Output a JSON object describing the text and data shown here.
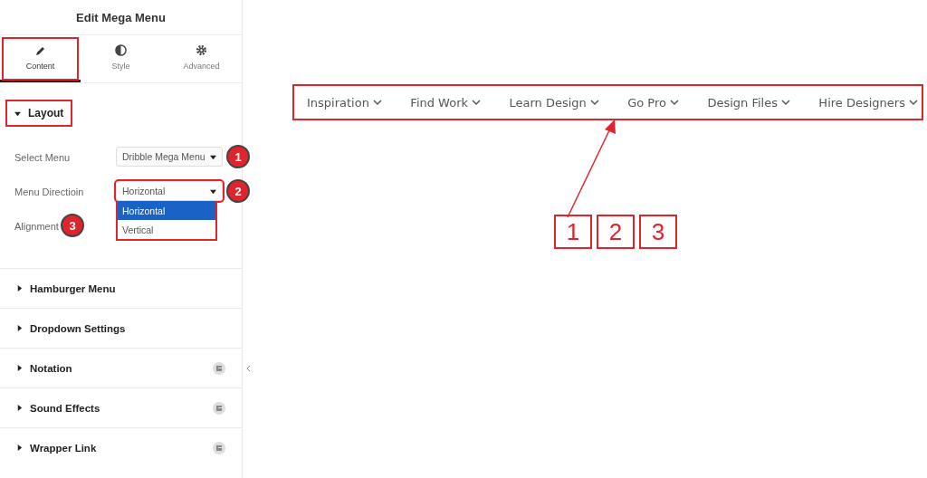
{
  "panel": {
    "title": "Edit Mega Menu",
    "tabs": [
      {
        "label": "Content",
        "selected": true,
        "highlighted": true
      },
      {
        "label": "Style",
        "selected": false,
        "highlighted": false
      },
      {
        "label": "Advanced",
        "selected": false,
        "highlighted": false
      }
    ],
    "layout": {
      "title": "Layout",
      "expanded": true,
      "highlighted": true,
      "fields": [
        {
          "label": "Select Menu",
          "value": "Dribble Mega Menu",
          "marker": "1",
          "highlighted": false
        },
        {
          "label": "Menu Directioin",
          "value": "Horizontal",
          "marker": "2",
          "open": true,
          "highlighted": true,
          "options": [
            {
              "label": "Horizontal",
              "selected": true
            },
            {
              "label": "Vertical",
              "selected": false
            }
          ]
        },
        {
          "label": "Alignment",
          "marker": "3"
        }
      ]
    },
    "sections": [
      {
        "title": "Hamburger Menu",
        "pro": false
      },
      {
        "title": "Dropdown Settings",
        "pro": false
      },
      {
        "title": "Notation",
        "pro": true
      },
      {
        "title": "Sound Effects",
        "pro": true
      },
      {
        "title": "Wrapper Link",
        "pro": true
      }
    ]
  },
  "menu": {
    "highlighted": true,
    "items": [
      "Inspiration",
      "Find Work",
      "Learn Design",
      "Go Pro",
      "Design Files",
      "Hire Designers"
    ]
  },
  "number_boxes": [
    "1",
    "2",
    "3"
  ]
}
